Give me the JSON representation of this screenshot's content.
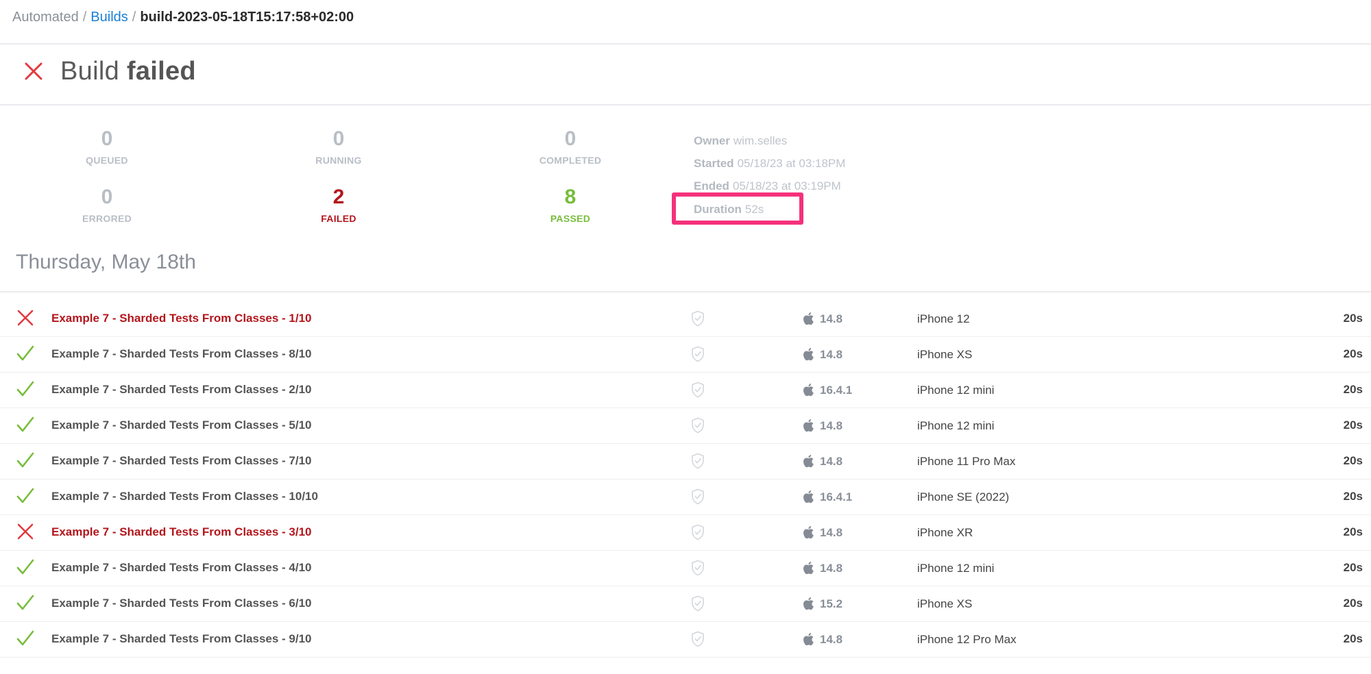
{
  "breadcrumb": {
    "root": "Automated",
    "builds": "Builds",
    "current": "build-2023-05-18T15:17:58+02:00",
    "separator": "/"
  },
  "header": {
    "prefix": "Build",
    "status": "failed",
    "icon": "close-icon"
  },
  "stats": {
    "queued": {
      "value": "0",
      "label": "QUEUED"
    },
    "running": {
      "value": "0",
      "label": "RUNNING"
    },
    "completed": {
      "value": "0",
      "label": "COMPLETED"
    },
    "errored": {
      "value": "0",
      "label": "ERRORED"
    },
    "failed": {
      "value": "2",
      "label": "FAILED"
    },
    "passed": {
      "value": "8",
      "label": "PASSED"
    }
  },
  "meta": {
    "owner_label": "Owner",
    "owner": "wim.selles",
    "started_label": "Started",
    "started": "05/18/23 at 03:18PM",
    "ended_label": "Ended",
    "ended": "05/18/23 at 03:19PM",
    "duration_label": "Duration",
    "duration": "52s"
  },
  "date_heading": "Thursday, May 18th",
  "colors": {
    "fail": "#b3161c",
    "pass": "#77bd3b",
    "link": "#1a7fd4",
    "highlight": "#f5317c"
  },
  "jobs": [
    {
      "status": "failed",
      "name": "Example 7 - Sharded Tests From Classes - 1/10",
      "os": "14.8",
      "device": "iPhone 12",
      "duration": "20s"
    },
    {
      "status": "passed",
      "name": "Example 7 - Sharded Tests From Classes - 8/10",
      "os": "14.8",
      "device": "iPhone XS",
      "duration": "20s"
    },
    {
      "status": "passed",
      "name": "Example 7 - Sharded Tests From Classes - 2/10",
      "os": "16.4.1",
      "device": "iPhone 12 mini",
      "duration": "20s"
    },
    {
      "status": "passed",
      "name": "Example 7 - Sharded Tests From Classes - 5/10",
      "os": "14.8",
      "device": "iPhone 12 mini",
      "duration": "20s"
    },
    {
      "status": "passed",
      "name": "Example 7 - Sharded Tests From Classes - 7/10",
      "os": "14.8",
      "device": "iPhone 11 Pro Max",
      "duration": "20s"
    },
    {
      "status": "passed",
      "name": "Example 7 - Sharded Tests From Classes - 10/10",
      "os": "16.4.1",
      "device": "iPhone SE (2022)",
      "duration": "20s"
    },
    {
      "status": "failed",
      "name": "Example 7 - Sharded Tests From Classes - 3/10",
      "os": "14.8",
      "device": "iPhone XR",
      "duration": "20s"
    },
    {
      "status": "passed",
      "name": "Example 7 - Sharded Tests From Classes - 4/10",
      "os": "14.8",
      "device": "iPhone 12 mini",
      "duration": "20s"
    },
    {
      "status": "passed",
      "name": "Example 7 - Sharded Tests From Classes - 6/10",
      "os": "15.2",
      "device": "iPhone XS",
      "duration": "20s"
    },
    {
      "status": "passed",
      "name": "Example 7 - Sharded Tests From Classes - 9/10",
      "os": "14.8",
      "device": "iPhone 12 Pro Max",
      "duration": "20s"
    }
  ]
}
